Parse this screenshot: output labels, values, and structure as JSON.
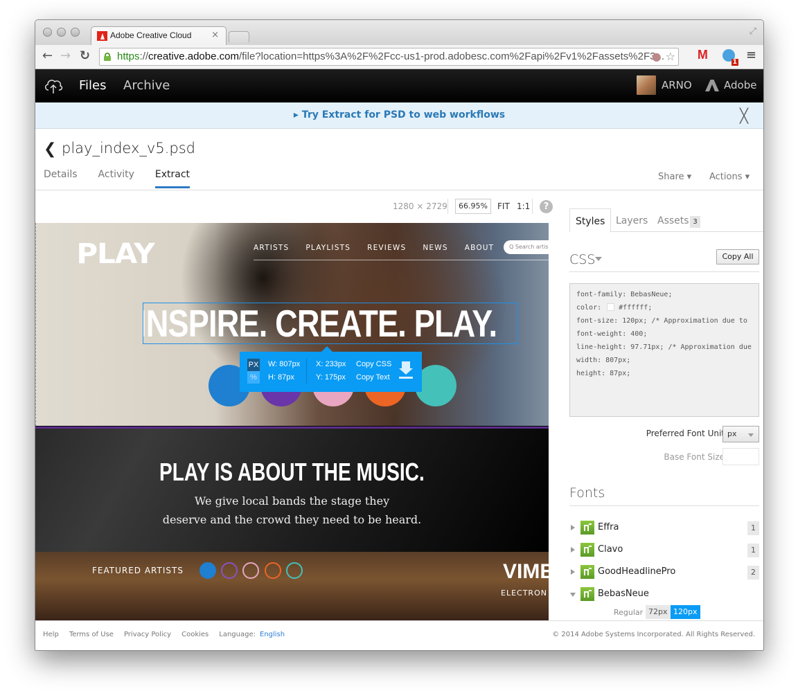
{
  "browser": {
    "tab_title": "Adobe Creative Cloud",
    "tab_close": "×",
    "url_scheme": "https",
    "url_sep": "://",
    "url_host": "creative.adobe.com",
    "url_rest": "/file?location=https%3A%2F%2Fcc-us1-prod.adobesc.com%2Fapi%2Fv1%2Fassets%2F3...",
    "ext_badge": "1"
  },
  "app": {
    "nav": {
      "files": "Files",
      "archive": "Archive"
    },
    "user_name": "ARNO",
    "brand": "Adobe"
  },
  "banner": {
    "text": "▸ Try Extract for PSD to web workflows",
    "close": "╳"
  },
  "file": {
    "back": "❮",
    "title": "play_index_v5.psd",
    "tabs": [
      {
        "label": "Details",
        "active": false
      },
      {
        "label": "Activity",
        "active": false
      },
      {
        "label": "Extract",
        "active": true
      }
    ],
    "share": "Share ▾",
    "actions": "Actions ▾"
  },
  "canvas_toolbar": {
    "dimensions": "1280 × 2729",
    "zoom": "66.95%",
    "fit": "FIT",
    "one_to_one": "1:1",
    "help": "?"
  },
  "preview": {
    "logo": "PLAY",
    "nav": [
      "ARTISTS",
      "PLAYLISTS",
      "REVIEWS",
      "NEWS",
      "ABOUT"
    ],
    "search_placeholder": "Q  Search artist",
    "headline": "INSPIRE. CREATE. PLAY.",
    "circle_colors": [
      "#1f7fd0",
      "#6a35a8",
      "#e9a6c0",
      "#ec6524",
      "#44c1b9"
    ],
    "section_title": "PLAY IS ABOUT THE MUSIC.",
    "section_sub_1": "We give local bands the stage they",
    "section_sub_2": "deserve and the crowd they need to be heard.",
    "featured_label": "FEATURED ARTISTS",
    "featured_dots": [
      "#1f7fd0",
      "#8a52c0",
      "#e9a6c0",
      "#ec6524",
      "#44c1b9"
    ],
    "featured_title": "VIME",
    "featured_sub": "ELECTRON"
  },
  "measure_tooltip": {
    "unit_px": "PX",
    "unit_pct": "%",
    "width": "W: 807px",
    "height": "H: 87px",
    "x": "X: 233px",
    "y": "Y: 175px",
    "copy_css": "Copy CSS",
    "copy_text": "Copy Text"
  },
  "right_panel": {
    "tabs": [
      {
        "label": "Styles",
        "active": true
      },
      {
        "label": "Layers",
        "active": false
      },
      {
        "label": "Assets",
        "active": false,
        "badge": "3"
      }
    ],
    "css_heading": "CSS",
    "copy_all": "Copy All",
    "css_lines": [
      "font-family: BebasNeue;",
      "color: #ffffff;",
      "font-size: 120px; /* Approximation due to",
      "font-weight: 400;",
      "line-height: 97.71px; /* Approximation due",
      "width: 807px;",
      "height: 87px;"
    ],
    "color_value": "#ffffff",
    "preferred_font_unit_label": "Preferred Font Unit",
    "preferred_font_unit_value": "px",
    "base_font_size_label": "Base Font Size",
    "base_font_size_value": "",
    "fonts_heading": "Fonts",
    "fonts": [
      {
        "name": "Effra",
        "count": "1",
        "expanded": false
      },
      {
        "name": "Clavo",
        "count": "1",
        "expanded": false
      },
      {
        "name": "GoodHeadlinePro",
        "count": "2",
        "expanded": false
      },
      {
        "name": "BebasNeue",
        "count": "",
        "expanded": true
      }
    ],
    "bebas_style": "Regular",
    "bebas_sizes": [
      {
        "label": "72px",
        "selected": false
      },
      {
        "label": "120px",
        "selected": true
      }
    ]
  },
  "footer": {
    "links": [
      "Help",
      "Terms of Use",
      "Privacy Policy",
      "Cookies"
    ],
    "language_label": "Language:",
    "language_value": "English",
    "copyright": "© 2014 Adobe Systems Incorporated. All Rights Reserved."
  }
}
